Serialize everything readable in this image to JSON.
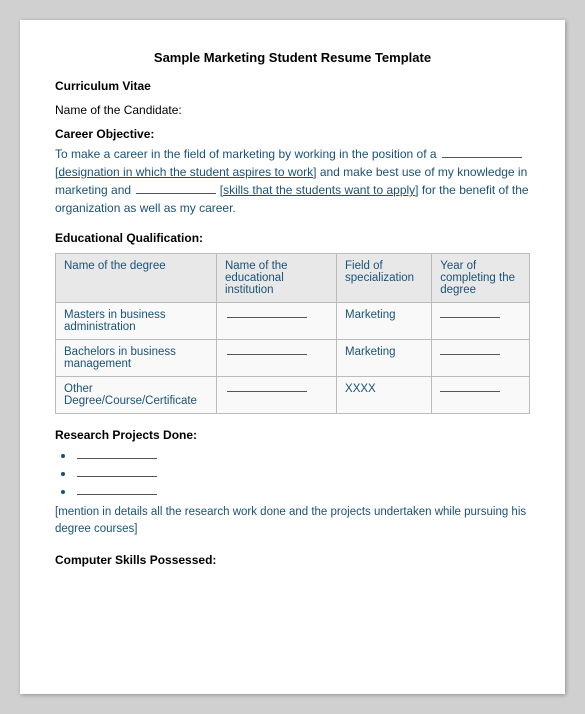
{
  "page": {
    "title": "Sample Marketing Student Resume Template",
    "sections": {
      "curriculum_vitae": {
        "label": "Curriculum Vitae"
      },
      "candidate": {
        "label": "Name of the Candidate:"
      },
      "career_objective": {
        "label": "Career Objective:",
        "text": "To make a career in the field of marketing by working in the position of a ________________ [designation in which the student aspires to work] and make best use of my knowledge in marketing and ________________ [skills that the students want to apply] for the benefit of the organization as well as my career."
      },
      "educational": {
        "label": "Educational Qualification:",
        "table": {
          "headers": [
            "Name of the degree",
            "Name of the educational institution",
            "Field of specialization",
            "Year of completing the degree"
          ],
          "rows": [
            [
              "Masters in business administration",
              "",
              "Marketing",
              ""
            ],
            [
              "Bachelors in business management",
              "",
              "Marketing",
              ""
            ],
            [
              "Other Degree/Course/Certificate",
              "",
              "XXXX",
              ""
            ]
          ]
        }
      },
      "research": {
        "label": "Research Projects Done:",
        "bullets": [
          "________________",
          "________________",
          "________________"
        ],
        "note": "[mention in details all the research work done and the projects undertaken while pursuing his degree courses]"
      },
      "computer_skills": {
        "label": "Computer Skills Possessed:"
      }
    }
  }
}
